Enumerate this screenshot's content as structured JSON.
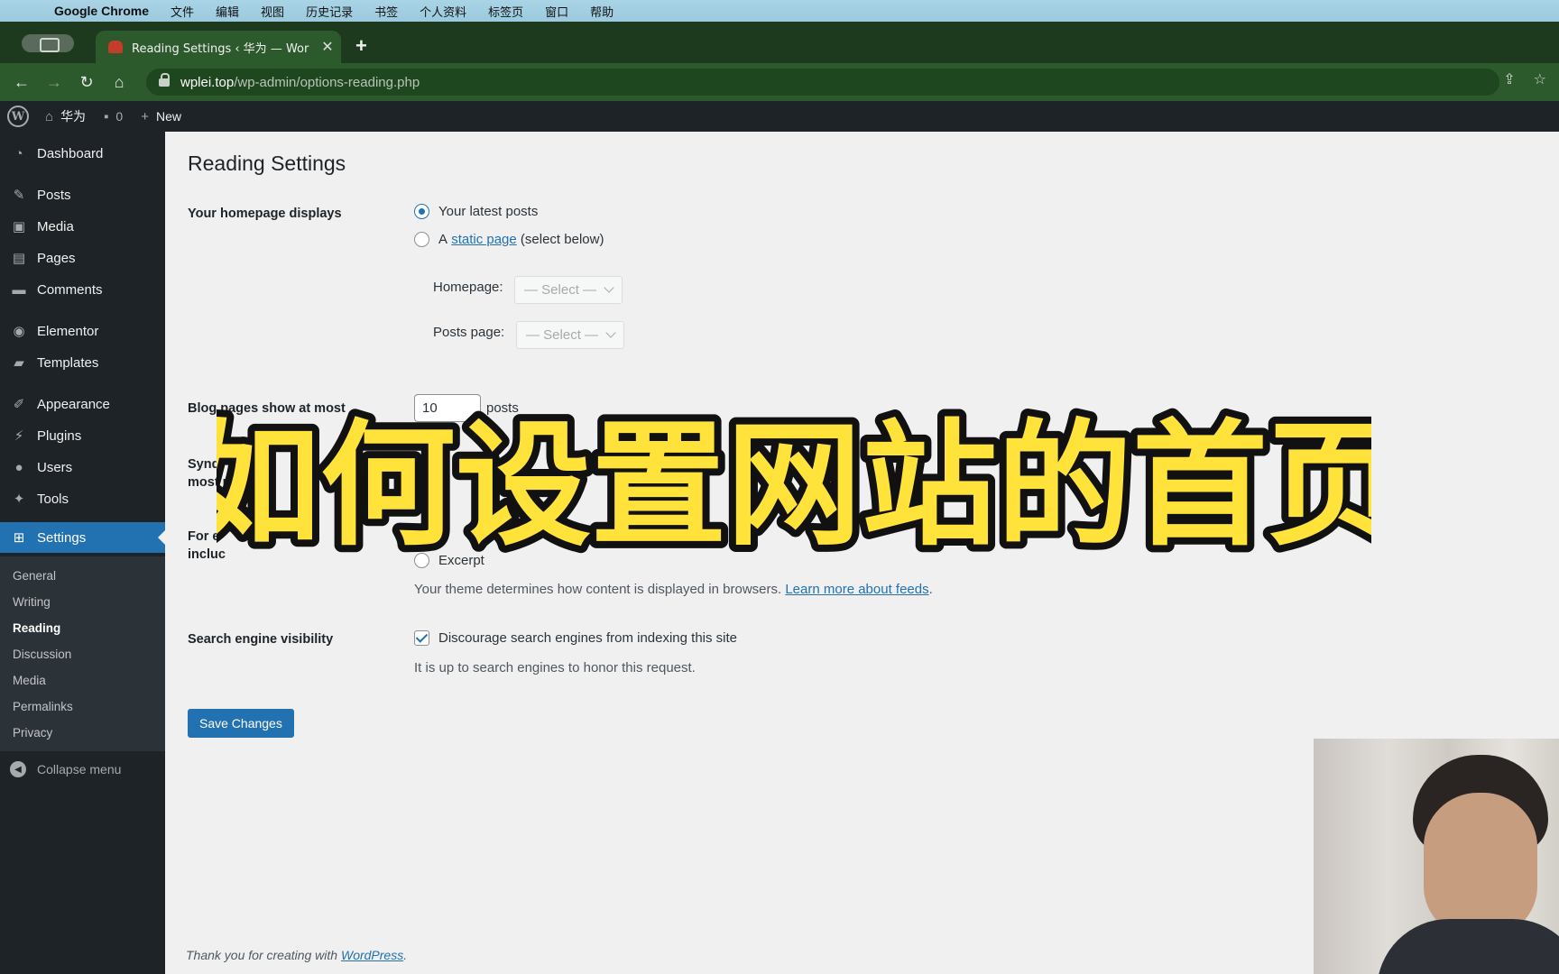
{
  "menubar": {
    "app": "Google Chrome",
    "items": [
      "文件",
      "编辑",
      "视图",
      "历史记录",
      "书签",
      "个人资料",
      "标签页",
      "窗口",
      "帮助"
    ]
  },
  "browser": {
    "tab_title": "Reading Settings ‹ 华为 — Wor",
    "url_host": "wplei.top",
    "url_path": "/wp-admin/options-reading.php"
  },
  "adminbar": {
    "site_name": "华为",
    "comment_count": "0",
    "new_label": "New"
  },
  "sidebar": {
    "items": [
      {
        "label": "Dashboard",
        "icon": "dashboard-icon"
      },
      {
        "label": "Posts",
        "icon": "pin-icon"
      },
      {
        "label": "Media",
        "icon": "media-icon"
      },
      {
        "label": "Pages",
        "icon": "pages-icon"
      },
      {
        "label": "Comments",
        "icon": "comment-icon"
      },
      {
        "label": "Elementor",
        "icon": "elementor-icon"
      },
      {
        "label": "Templates",
        "icon": "folder-icon"
      },
      {
        "label": "Appearance",
        "icon": "brush-icon"
      },
      {
        "label": "Plugins",
        "icon": "plugin-icon"
      },
      {
        "label": "Users",
        "icon": "user-icon"
      },
      {
        "label": "Tools",
        "icon": "wrench-icon"
      },
      {
        "label": "Settings",
        "icon": "settings-icon"
      }
    ],
    "submenu": [
      "General",
      "Writing",
      "Reading",
      "Discussion",
      "Media",
      "Permalinks",
      "Privacy"
    ],
    "collapse_label": "Collapse menu"
  },
  "main": {
    "title": "Reading Settings",
    "homepage_displays": {
      "label": "Your homepage displays",
      "opt_latest": "Your latest posts",
      "opt_static_prefix": "A",
      "opt_static_link": "static page",
      "opt_static_suffix": "(select below)",
      "homepage_label": "Homepage:",
      "homepage_value": "— Select —",
      "posts_page_label": "Posts page:",
      "posts_page_value": "— Select —"
    },
    "blog_pages": {
      "label": "Blog pages show at most",
      "value": "10",
      "unit": "posts"
    },
    "syndication": {
      "label_1": "Synd",
      "label_2": "most r"
    },
    "feed": {
      "label_1": "For e",
      "label_2": "incluc",
      "opt_excerpt": "Excerpt",
      "desc_prefix": "Your theme determines how content is displayed in browsers.",
      "desc_link": "Learn more about feeds",
      "desc_suffix": "."
    },
    "search_visibility": {
      "label": "Search engine visibility",
      "checkbox_label": "Discourage search engines from indexing this site",
      "desc": "It is up to search engines to honor this request."
    },
    "save_label": "Save Changes",
    "footer_prefix": "Thank you for creating with",
    "footer_link": "WordPress",
    "footer_suffix": "."
  },
  "caption": "如何设置网站的首页",
  "colors": {
    "wp_blue": "#2271b1",
    "admin_dark": "#1d2327",
    "caption_fill": "#ffe33a",
    "caption_stroke": "#111111"
  }
}
